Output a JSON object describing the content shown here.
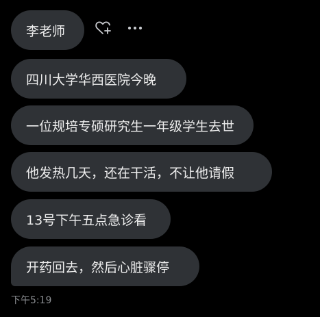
{
  "messages": [
    {
      "text": "李老师"
    },
    {
      "text": "四川大学华西医院今晚"
    },
    {
      "text": "一位规培专硕研究生一年级学生去世"
    },
    {
      "text": "他发热几天，还在干活，不让他请假"
    },
    {
      "text": "13号下午五点急诊看"
    },
    {
      "text": "开药回去，然后心脏骤停"
    }
  ],
  "timestamp": "下午5:19",
  "icons": {
    "react": "heart-plus-icon",
    "more": "more-horizontal-icon"
  },
  "colors": {
    "background": "#000000",
    "bubble": "#2f3236",
    "text": "#ededed",
    "timestamp": "#8a8d91",
    "icon": "#c9cbcf"
  }
}
